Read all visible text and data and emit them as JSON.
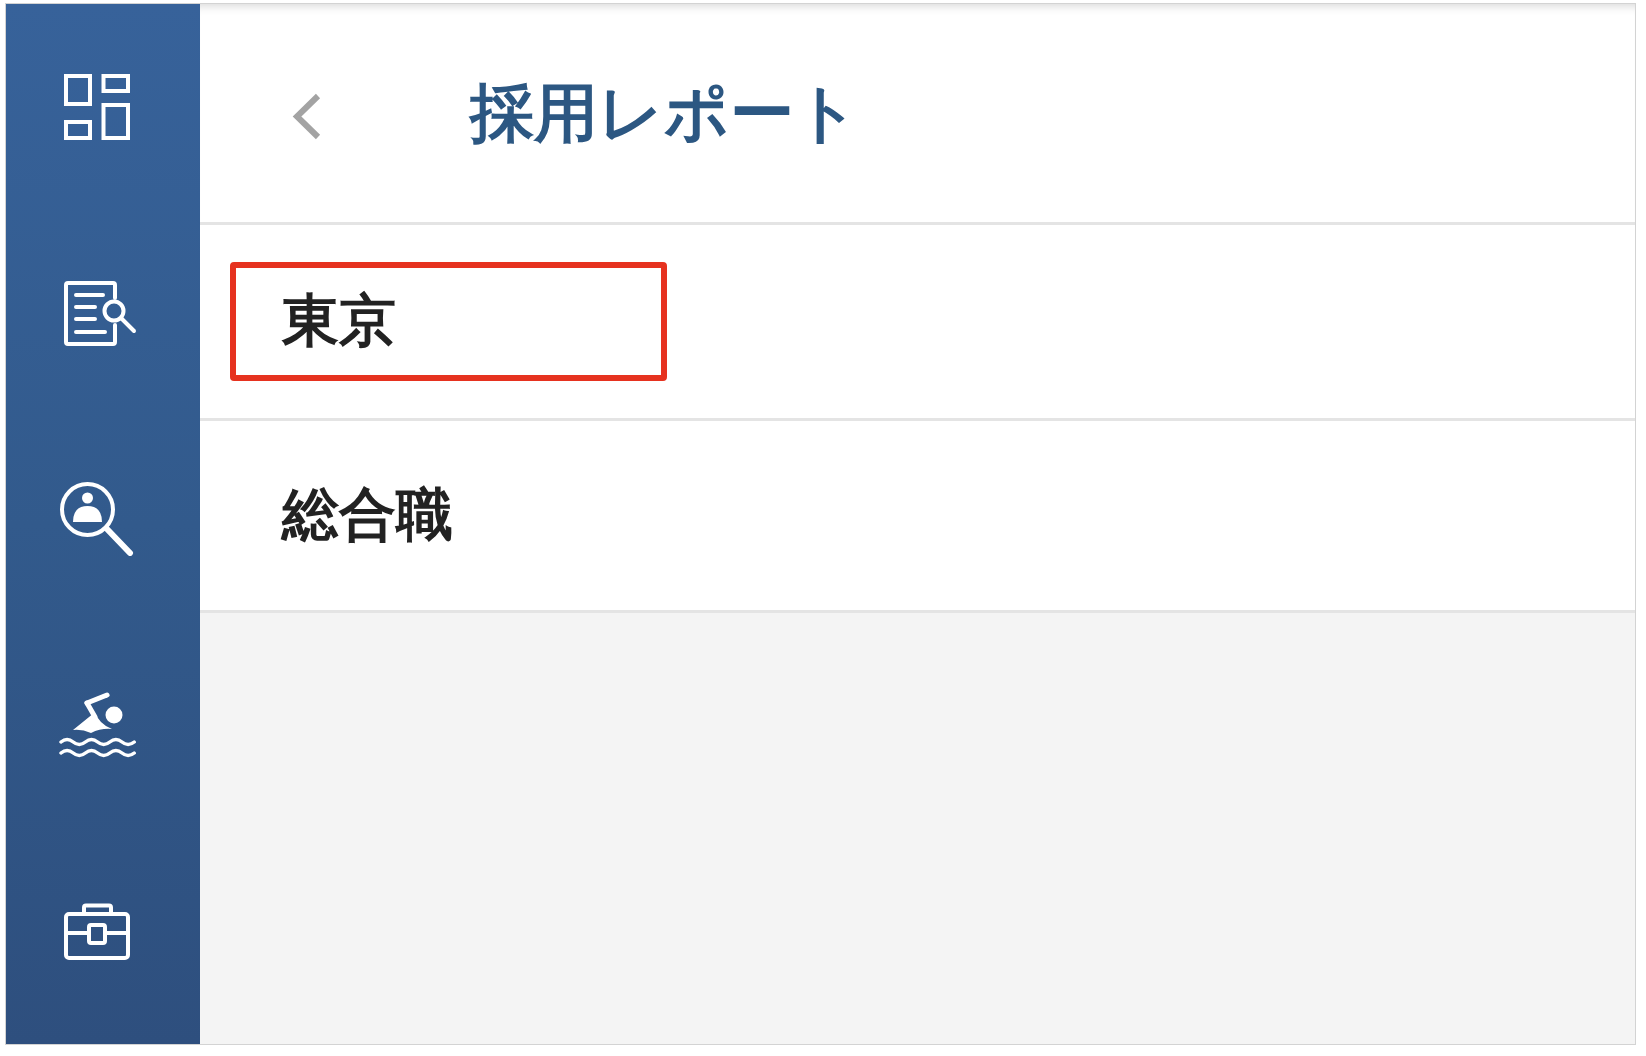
{
  "header": {
    "title": "採用レポート"
  },
  "list": {
    "items": [
      {
        "label": "東京",
        "highlighted": true
      },
      {
        "label": "総合職",
        "highlighted": false
      }
    ]
  }
}
